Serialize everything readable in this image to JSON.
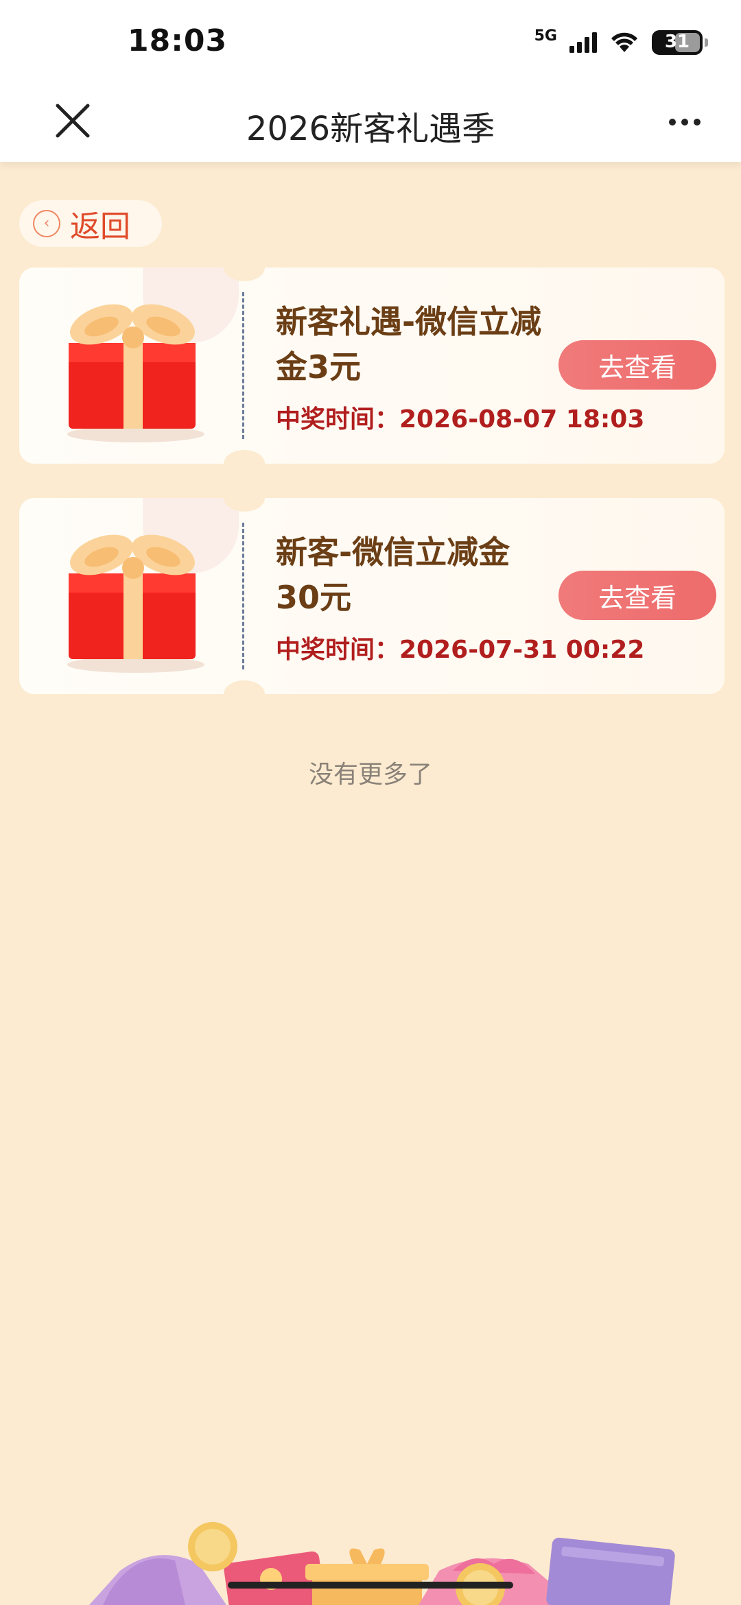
{
  "status_bar": {
    "time": "18:03",
    "network": "5G",
    "battery": "31"
  },
  "nav": {
    "title": "2026新客礼遇季"
  },
  "back": {
    "label": "返回"
  },
  "coupons": [
    {
      "title": "新客礼遇-微信立减金3元",
      "time": "中奖时间：2026-08-07 18:03",
      "button": "去查看"
    },
    {
      "title": "新客-微信立减金30元",
      "time": "中奖时间：2026-07-31 00:22",
      "button": "去查看"
    }
  ],
  "footer": {
    "no_more": "没有更多了"
  },
  "colors": {
    "background": "#fcebd0",
    "title_brown": "#6b3e15",
    "time_red": "#b11e1e",
    "button_coral": "#ee6b6b"
  }
}
